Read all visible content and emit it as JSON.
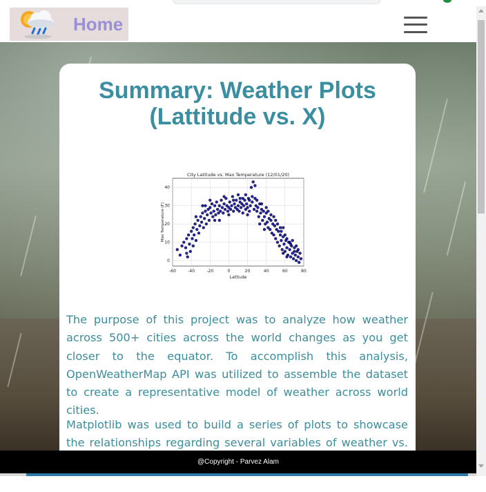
{
  "navbar": {
    "brand_label": "Home",
    "menu_icon": "hamburger-menu-icon",
    "logo_icon": "weather-cloud-rain-sun-icon"
  },
  "main": {
    "title_line1": "Summary: Weather Plots",
    "title_line2": "(Lattitude vs. X)",
    "paragraphs": [
      "The purpose of this project was to analyze how weather across 500+ cities across the world changes as you get closer to the equator. To accomplish this analysis, OpenWeatherMap API was utilized to assemble the dataset to create a representative model of weather across world cities.",
      "Matplotlib was used to build a series of plots to showcase the relationships regarding several variables of weather vs. latitude."
    ]
  },
  "chart_data": {
    "type": "scatter",
    "title": "City Latitude vs. Max Temperature (12/01/20)",
    "xlabel": "Latitude",
    "ylabel": "Max Temperature (F)",
    "xlim": [
      -60,
      80
    ],
    "ylim": [
      -3,
      45
    ],
    "xticks": [
      -60,
      -40,
      -20,
      0,
      20,
      40,
      60,
      80
    ],
    "yticks": [
      0,
      10,
      20,
      30,
      40
    ],
    "grid": true,
    "marker_color": "#00008b",
    "points": [
      [
        -55,
        6
      ],
      [
        -52,
        3
      ],
      [
        -50,
        8
      ],
      [
        -48,
        10
      ],
      [
        -46,
        7
      ],
      [
        -45,
        12
      ],
      [
        -44,
        2
      ],
      [
        -43,
        14
      ],
      [
        -42,
        9
      ],
      [
        -41,
        5
      ],
      [
        -40,
        16
      ],
      [
        -39,
        12
      ],
      [
        -38,
        18
      ],
      [
        -37,
        14
      ],
      [
        -36,
        20
      ],
      [
        -35,
        11
      ],
      [
        -34,
        17
      ],
      [
        -33,
        22
      ],
      [
        -32,
        15
      ],
      [
        -31,
        19
      ],
      [
        -30,
        24
      ],
      [
        -29,
        21
      ],
      [
        -28,
        26
      ],
      [
        -27,
        18
      ],
      [
        -26,
        23
      ],
      [
        -25,
        27
      ],
      [
        -24,
        20
      ],
      [
        -23,
        25
      ],
      [
        -22,
        28
      ],
      [
        -21,
        22
      ],
      [
        -20,
        29
      ],
      [
        -19,
        26
      ],
      [
        -18,
        31
      ],
      [
        -17,
        24
      ],
      [
        -16,
        27
      ],
      [
        -15,
        30
      ],
      [
        -14,
        25
      ],
      [
        -13,
        32
      ],
      [
        -12,
        28
      ],
      [
        -11,
        26
      ],
      [
        -10,
        30
      ],
      [
        -9,
        27
      ],
      [
        -8,
        33
      ],
      [
        -7,
        29
      ],
      [
        -6,
        26
      ],
      [
        -5,
        31
      ],
      [
        -4,
        28
      ],
      [
        -3,
        34
      ],
      [
        -2,
        30
      ],
      [
        -1,
        27
      ],
      [
        0,
        29
      ],
      [
        1,
        32
      ],
      [
        2,
        28
      ],
      [
        3,
        30
      ],
      [
        4,
        35
      ],
      [
        5,
        27
      ],
      [
        6,
        31
      ],
      [
        7,
        29
      ],
      [
        8,
        33
      ],
      [
        9,
        28
      ],
      [
        10,
        30
      ],
      [
        11,
        27
      ],
      [
        12,
        32
      ],
      [
        13,
        29
      ],
      [
        14,
        31
      ],
      [
        15,
        26
      ],
      [
        16,
        30
      ],
      [
        17,
        33
      ],
      [
        18,
        28
      ],
      [
        19,
        31
      ],
      [
        20,
        29
      ],
      [
        21,
        34
      ],
      [
        22,
        27
      ],
      [
        23,
        30
      ],
      [
        24,
        40
      ],
      [
        25,
        32
      ],
      [
        26,
        43
      ],
      [
        27,
        28
      ],
      [
        28,
        41
      ],
      [
        29,
        30
      ],
      [
        30,
        27
      ],
      [
        31,
        29
      ],
      [
        32,
        24
      ],
      [
        33,
        31
      ],
      [
        34,
        26
      ],
      [
        35,
        28
      ],
      [
        36,
        22
      ],
      [
        37,
        27
      ],
      [
        38,
        24
      ],
      [
        39,
        20
      ],
      [
        40,
        26
      ],
      [
        41,
        21
      ],
      [
        42,
        18
      ],
      [
        43,
        23
      ],
      [
        44,
        17
      ],
      [
        45,
        22
      ],
      [
        46,
        15
      ],
      [
        47,
        20
      ],
      [
        48,
        14
      ],
      [
        49,
        19
      ],
      [
        50,
        12
      ],
      [
        51,
        17
      ],
      [
        52,
        10
      ],
      [
        53,
        16
      ],
      [
        54,
        8
      ],
      [
        55,
        14
      ],
      [
        56,
        11
      ],
      [
        57,
        6
      ],
      [
        58,
        13
      ],
      [
        59,
        9
      ],
      [
        60,
        5
      ],
      [
        61,
        11
      ],
      [
        62,
        7
      ],
      [
        63,
        3
      ],
      [
        64,
        10
      ],
      [
        65,
        6
      ],
      [
        66,
        2
      ],
      [
        67,
        8
      ],
      [
        68,
        4
      ],
      [
        69,
        1
      ],
      [
        70,
        7
      ],
      [
        71,
        3
      ],
      [
        72,
        0
      ],
      [
        73,
        5
      ],
      [
        74,
        2
      ],
      [
        75,
        -1
      ],
      [
        76,
        4
      ],
      [
        77,
        1
      ],
      [
        -35,
        24
      ],
      [
        -28,
        30
      ],
      [
        -20,
        33
      ],
      [
        -15,
        22
      ],
      [
        -5,
        35
      ],
      [
        0,
        25
      ],
      [
        5,
        33
      ],
      [
        10,
        36
      ],
      [
        15,
        34
      ],
      [
        20,
        25
      ],
      [
        25,
        35
      ],
      [
        30,
        33
      ],
      [
        35,
        31
      ],
      [
        40,
        29
      ],
      [
        45,
        25
      ],
      [
        50,
        22
      ],
      [
        55,
        18
      ],
      [
        60,
        14
      ],
      [
        65,
        10
      ],
      [
        70,
        5
      ],
      [
        -45,
        4
      ],
      [
        -38,
        8
      ],
      [
        -25,
        30
      ],
      [
        -10,
        22
      ],
      [
        12,
        34
      ],
      [
        18,
        36
      ],
      [
        22,
        33
      ],
      [
        28,
        34
      ],
      [
        33,
        20
      ],
      [
        38,
        17
      ],
      [
        42,
        27
      ],
      [
        48,
        24
      ],
      [
        52,
        20
      ],
      [
        56,
        16
      ],
      [
        58,
        4
      ],
      [
        62,
        12
      ],
      [
        66,
        9
      ],
      [
        68,
        11
      ],
      [
        72,
        8
      ],
      [
        74,
        6
      ],
      [
        62,
        2
      ],
      [
        58,
        18
      ]
    ]
  }
}
